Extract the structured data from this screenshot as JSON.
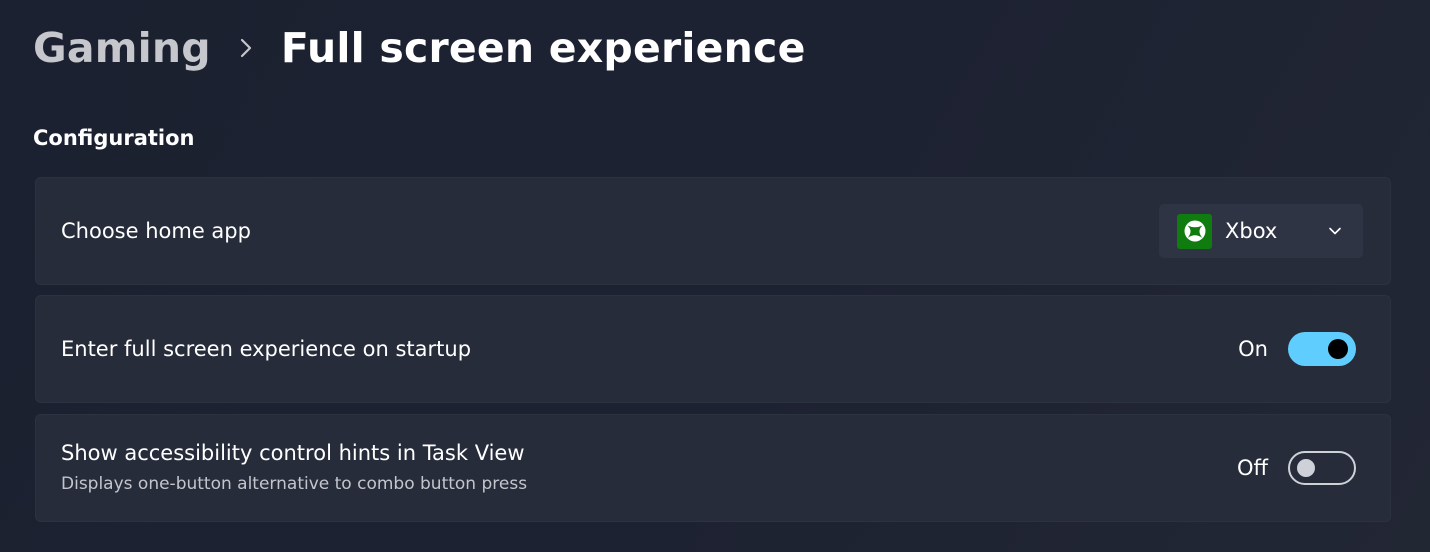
{
  "breadcrumb": {
    "parent": "Gaming",
    "current": "Full screen experience"
  },
  "section": {
    "title": "Configuration"
  },
  "settings": {
    "home_app": {
      "label": "Choose home app",
      "value": "Xbox",
      "icon": "xbox-logo-icon"
    },
    "startup": {
      "label": "Enter full screen experience on startup",
      "state": "On"
    },
    "hints": {
      "label": "Show accessibility control hints in Task View",
      "description": "Displays one-button alternative to combo button press",
      "state": "Off"
    }
  },
  "colors": {
    "accent": "#60cdff",
    "xbox_green": "#107c10",
    "card_bg": "#272c3b",
    "page_bg": "#1c2131"
  }
}
